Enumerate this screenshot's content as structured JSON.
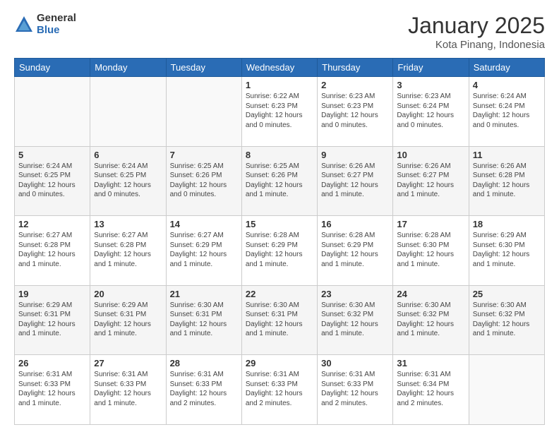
{
  "header": {
    "logo_general": "General",
    "logo_blue": "Blue",
    "title": "January 2025",
    "subtitle": "Kota Pinang, Indonesia"
  },
  "weekdays": [
    "Sunday",
    "Monday",
    "Tuesday",
    "Wednesday",
    "Thursday",
    "Friday",
    "Saturday"
  ],
  "weeks": [
    [
      {
        "day": "",
        "info": ""
      },
      {
        "day": "",
        "info": ""
      },
      {
        "day": "",
        "info": ""
      },
      {
        "day": "1",
        "info": "Sunrise: 6:22 AM\nSunset: 6:23 PM\nDaylight: 12 hours\nand 0 minutes."
      },
      {
        "day": "2",
        "info": "Sunrise: 6:23 AM\nSunset: 6:23 PM\nDaylight: 12 hours\nand 0 minutes."
      },
      {
        "day": "3",
        "info": "Sunrise: 6:23 AM\nSunset: 6:24 PM\nDaylight: 12 hours\nand 0 minutes."
      },
      {
        "day": "4",
        "info": "Sunrise: 6:24 AM\nSunset: 6:24 PM\nDaylight: 12 hours\nand 0 minutes."
      }
    ],
    [
      {
        "day": "5",
        "info": "Sunrise: 6:24 AM\nSunset: 6:25 PM\nDaylight: 12 hours\nand 0 minutes."
      },
      {
        "day": "6",
        "info": "Sunrise: 6:24 AM\nSunset: 6:25 PM\nDaylight: 12 hours\nand 0 minutes."
      },
      {
        "day": "7",
        "info": "Sunrise: 6:25 AM\nSunset: 6:26 PM\nDaylight: 12 hours\nand 0 minutes."
      },
      {
        "day": "8",
        "info": "Sunrise: 6:25 AM\nSunset: 6:26 PM\nDaylight: 12 hours\nand 1 minute."
      },
      {
        "day": "9",
        "info": "Sunrise: 6:26 AM\nSunset: 6:27 PM\nDaylight: 12 hours\nand 1 minute."
      },
      {
        "day": "10",
        "info": "Sunrise: 6:26 AM\nSunset: 6:27 PM\nDaylight: 12 hours\nand 1 minute."
      },
      {
        "day": "11",
        "info": "Sunrise: 6:26 AM\nSunset: 6:28 PM\nDaylight: 12 hours\nand 1 minute."
      }
    ],
    [
      {
        "day": "12",
        "info": "Sunrise: 6:27 AM\nSunset: 6:28 PM\nDaylight: 12 hours\nand 1 minute."
      },
      {
        "day": "13",
        "info": "Sunrise: 6:27 AM\nSunset: 6:28 PM\nDaylight: 12 hours\nand 1 minute."
      },
      {
        "day": "14",
        "info": "Sunrise: 6:27 AM\nSunset: 6:29 PM\nDaylight: 12 hours\nand 1 minute."
      },
      {
        "day": "15",
        "info": "Sunrise: 6:28 AM\nSunset: 6:29 PM\nDaylight: 12 hours\nand 1 minute."
      },
      {
        "day": "16",
        "info": "Sunrise: 6:28 AM\nSunset: 6:29 PM\nDaylight: 12 hours\nand 1 minute."
      },
      {
        "day": "17",
        "info": "Sunrise: 6:28 AM\nSunset: 6:30 PM\nDaylight: 12 hours\nand 1 minute."
      },
      {
        "day": "18",
        "info": "Sunrise: 6:29 AM\nSunset: 6:30 PM\nDaylight: 12 hours\nand 1 minute."
      }
    ],
    [
      {
        "day": "19",
        "info": "Sunrise: 6:29 AM\nSunset: 6:31 PM\nDaylight: 12 hours\nand 1 minute."
      },
      {
        "day": "20",
        "info": "Sunrise: 6:29 AM\nSunset: 6:31 PM\nDaylight: 12 hours\nand 1 minute."
      },
      {
        "day": "21",
        "info": "Sunrise: 6:30 AM\nSunset: 6:31 PM\nDaylight: 12 hours\nand 1 minute."
      },
      {
        "day": "22",
        "info": "Sunrise: 6:30 AM\nSunset: 6:31 PM\nDaylight: 12 hours\nand 1 minute."
      },
      {
        "day": "23",
        "info": "Sunrise: 6:30 AM\nSunset: 6:32 PM\nDaylight: 12 hours\nand 1 minute."
      },
      {
        "day": "24",
        "info": "Sunrise: 6:30 AM\nSunset: 6:32 PM\nDaylight: 12 hours\nand 1 minute."
      },
      {
        "day": "25",
        "info": "Sunrise: 6:30 AM\nSunset: 6:32 PM\nDaylight: 12 hours\nand 1 minute."
      }
    ],
    [
      {
        "day": "26",
        "info": "Sunrise: 6:31 AM\nSunset: 6:33 PM\nDaylight: 12 hours\nand 1 minute."
      },
      {
        "day": "27",
        "info": "Sunrise: 6:31 AM\nSunset: 6:33 PM\nDaylight: 12 hours\nand 1 minute."
      },
      {
        "day": "28",
        "info": "Sunrise: 6:31 AM\nSunset: 6:33 PM\nDaylight: 12 hours\nand 2 minutes."
      },
      {
        "day": "29",
        "info": "Sunrise: 6:31 AM\nSunset: 6:33 PM\nDaylight: 12 hours\nand 2 minutes."
      },
      {
        "day": "30",
        "info": "Sunrise: 6:31 AM\nSunset: 6:33 PM\nDaylight: 12 hours\nand 2 minutes."
      },
      {
        "day": "31",
        "info": "Sunrise: 6:31 AM\nSunset: 6:34 PM\nDaylight: 12 hours\nand 2 minutes."
      },
      {
        "day": "",
        "info": ""
      }
    ]
  ]
}
